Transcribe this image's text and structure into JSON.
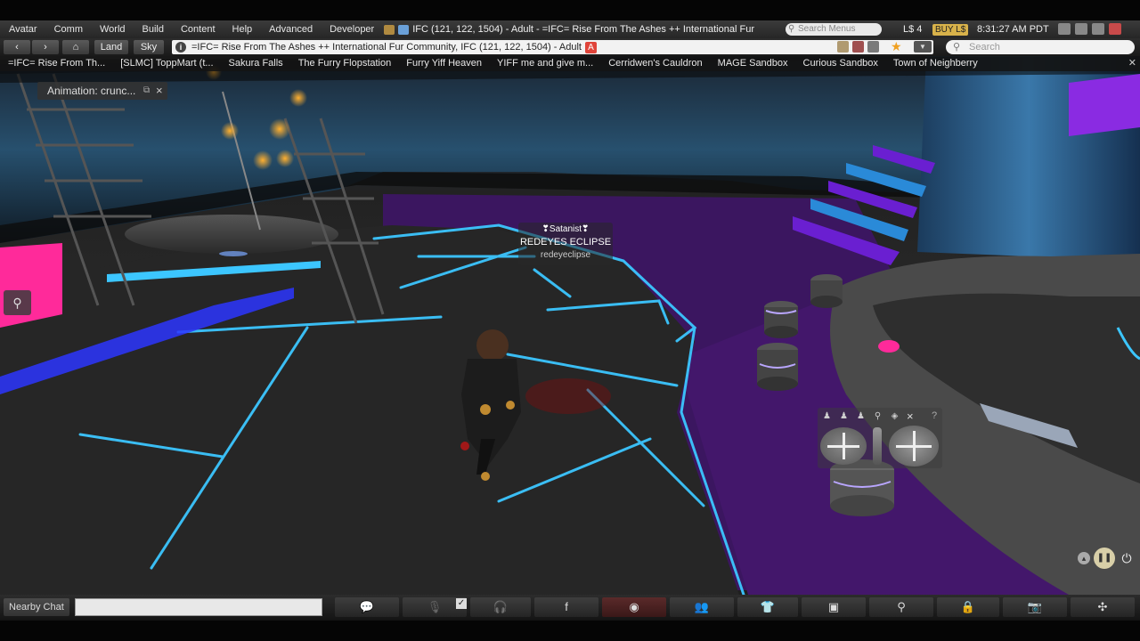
{
  "menu": {
    "items": [
      "Avatar",
      "Comm",
      "World",
      "Build",
      "Content",
      "Help",
      "Advanced",
      "Developer"
    ],
    "location": "IFC (121, 122, 1504) - Adult - =IFC= Rise From The Ashes ++ International Fur",
    "search_placeholder": "Search Menus",
    "balance": "L$ 4",
    "buy_label": "BUY L$",
    "clock": "8:31:27 AM PDT"
  },
  "nav": {
    "land_label": "Land",
    "sky_label": "Sky",
    "url": "=IFC= Rise From The Ashes ++ International Fur Community, IFC (121, 122, 1504) - Adult",
    "adult_badge": "A",
    "info_glyph": "i",
    "search_placeholder": "Search"
  },
  "favorites": [
    "=IFC= Rise From Th...",
    "[SLMC] ToppMart (t...",
    "Sakura Falls",
    "The Furry Flopstation",
    "Furry Yiff Heaven",
    "YIFF me and give m...",
    "Cerridwen's Cauldron",
    "MAGE Sandbox",
    "Curious Sandbox",
    "Town of Neighberry"
  ],
  "animation_toast": {
    "label": "Animation: crunc...",
    "close": "×"
  },
  "nametag": {
    "group": "❣Satanist❣",
    "display_name": "REDEYES ECLIPSE",
    "username": "redeyeclipse"
  },
  "camera": {
    "help": "?",
    "close": "×",
    "zoom_plus": "+",
    "zoom_minus": "−"
  },
  "bottom": {
    "chat_label": "Nearby Chat",
    "chat_value": "",
    "check": "✓"
  },
  "toolbar_icons": [
    "speak-icon",
    "microphone-icon",
    "headphones-icon",
    "facebook-icon",
    "view-eye-icon",
    "people-icon",
    "appearance-shirt-icon",
    "inventory-icon",
    "search-icon",
    "lock-icon",
    "snapshot-camera-icon",
    "move-icon"
  ],
  "colors": {
    "neon_blue": "#3cc6ff",
    "neon_purple": "#8a2be2",
    "floor_purple": "#3b1660",
    "magenta": "#ff2a9a",
    "adult_red": "#e0443a",
    "buy_gold": "#d8b24a"
  }
}
